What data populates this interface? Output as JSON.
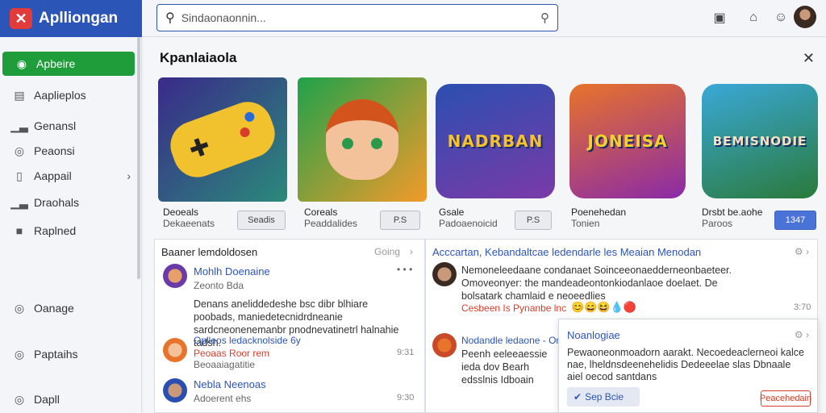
{
  "app": {
    "name": "Aplliongan",
    "logo_glyph": "✕"
  },
  "search": {
    "value": "Sindaonaonnin..."
  },
  "sidebar": {
    "items": [
      {
        "label": "Apbeire",
        "icon": "app-icon"
      },
      {
        "label": "Aaplieplos",
        "icon": "document-icon"
      },
      {
        "label": "Genansl",
        "icon": "chart-icon"
      },
      {
        "label": "Peaonsi",
        "icon": "circle-icon"
      },
      {
        "label": "Aappail",
        "icon": "square-icon"
      },
      {
        "label": "Draohals",
        "icon": "chart-icon"
      },
      {
        "label": "Raplned",
        "icon": "cube-icon"
      },
      {
        "label": "Oanage",
        "icon": "circle-icon"
      },
      {
        "label": "Paptaihs",
        "icon": "circle-icon"
      },
      {
        "label": "Dapll",
        "icon": "circle-icon"
      }
    ]
  },
  "main": {
    "title": "Kpanlaiaola",
    "games": [
      {
        "name": "Deoeals",
        "category": "Dekaeenats",
        "button": "Seadis",
        "banner": ""
      },
      {
        "name": "Coreals",
        "category": "Peaddalides",
        "button": "P.S",
        "banner": ""
      },
      {
        "name": "Gsale",
        "category": "Padoaenoicid",
        "button": "P.S",
        "banner": "NADRBAN"
      },
      {
        "name": "Poenehedan",
        "category": "Tonien",
        "button": "",
        "banner": "JONEISA"
      },
      {
        "name": "Drsbt be.aohe",
        "category": "Paroos",
        "button": "1347",
        "banner": "BEMISNODIE"
      }
    ]
  },
  "left_panel": {
    "title": "Baaner lemdoldosen",
    "link": "Going",
    "posts": [
      {
        "name": "Mohlh Doenaine",
        "sub": "Zeonto Bda",
        "time": ""
      },
      {
        "name": "Oplleos ledacknolside 6y",
        "sub": "Beoaaiagatitie",
        "red": "Peoaas Roor rem",
        "time": "9:31"
      },
      {
        "name": "Nebla Neenoas",
        "sub": "Adoerent ehs",
        "time": "9:30"
      }
    ],
    "body": "Denans aneliddedeshe bsc dibr blhiare poobads, maniedetecnidrdneanie sardcneonenemanbr pnodnevatinetrl halnahie tadsh.",
    "dots": "• • •"
  },
  "right_panel": {
    "title": "Acccartan, Kebandaltcae ledendarle les Meaian Menodan",
    "posts": [
      {
        "body": "Nemoneleedaane condanaet Soinceeonaedderneonbaeteer. Omoveonyer: the mandeadeontonkiodanlaoe doelaet. De bolsatark chamlaid e neoeedlies",
        "red": "Cesbeen Is Pynanbe lnc",
        "time": "3:70"
      },
      {
        "name": "Nodandle ledaone - Onin",
        "body": "Peenh eeleeaessie ieda dov Bearh edsslnis Idboain",
        "time": ""
      }
    ],
    "emojis": "😊😄😆💧🔴"
  },
  "popup": {
    "title": "Noanlogiae",
    "body": "Pewaoneonmoadorn aarakt. Necoedeaclerneoi kalce nae, lheldnsdeenehelidis Dedeeelae slas Dbnaale aiel oecod santdans",
    "primary": "Sep Bcie",
    "secondary": "Peacehedain"
  },
  "colors": {
    "brand": "#2c55b8",
    "active": "#1f9d3a",
    "alert": "#d83c2a"
  }
}
